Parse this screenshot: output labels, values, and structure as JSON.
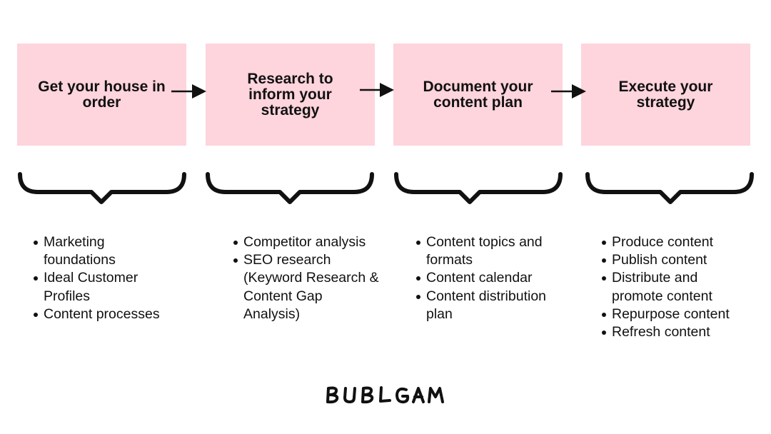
{
  "steps": [
    {
      "title": "Get your house in order",
      "items": [
        "Marketing foundations",
        "Ideal Customer Profiles",
        "Content processes"
      ]
    },
    {
      "title": "Research to inform your strategy",
      "items": [
        "Competitor analysis",
        "SEO research (Keyword Research & Content Gap Analysis)"
      ]
    },
    {
      "title": "Document your content plan",
      "items": [
        "Content topics and formats",
        "Content calendar",
        "Content distribution plan"
      ]
    },
    {
      "title": "Execute your strategy",
      "items": [
        "Produce content",
        "Publish content",
        "Distribute and promote content",
        "Repurpose content",
        "Refresh content"
      ]
    }
  ],
  "logo": "BUBLGAM",
  "colors": {
    "box": "#fed4dd",
    "ink": "#111111"
  }
}
